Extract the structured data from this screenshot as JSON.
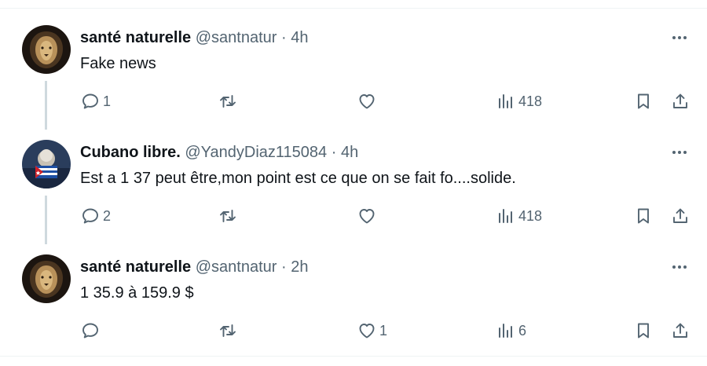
{
  "tweets": [
    {
      "name": "santé naturelle",
      "handle": "@santnatur",
      "separator": "·",
      "time": "4h",
      "text": "Fake news",
      "replies": "1",
      "retweets": "",
      "likes": "",
      "views": "418",
      "avatar_icon": "lion-avatar"
    },
    {
      "name": "Cubano libre.",
      "handle": "@YandyDiaz115084",
      "separator": "·",
      "time": "4h",
      "text": "Est a 1 37 peut être,mon point est ce que on se fait fo....solide.",
      "replies": "2",
      "retweets": "",
      "likes": "",
      "views": "418",
      "avatar_icon": "cuban-flag-avatar"
    },
    {
      "name": "santé naturelle",
      "handle": "@santnatur",
      "separator": "·",
      "time": "2h",
      "text": "1 35.9 à 159.9 $",
      "replies": "",
      "retweets": "",
      "likes": "1",
      "views": "6",
      "avatar_icon": "lion-avatar"
    }
  ],
  "colors": {
    "text_primary": "#0f1419",
    "text_secondary": "#536471",
    "thread_line": "#cfd9de",
    "divider": "#eff3f4"
  }
}
